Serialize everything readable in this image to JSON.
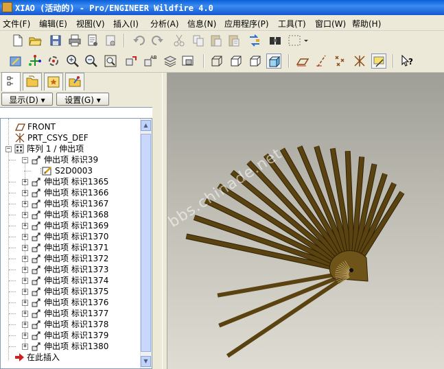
{
  "window": {
    "title": "XIAO (活动的) - Pro/ENGINEER Wildfire 4.0"
  },
  "menu": [
    "文件(F)",
    "编辑(E)",
    "视图(V)",
    "插入(I)",
    "分析(A)",
    "信息(N)",
    "应用程序(P)",
    "工具(T)",
    "窗口(W)",
    "帮助(H)"
  ],
  "toolbar1": [
    "new-icon",
    "open-icon",
    "save-icon",
    "print-icon",
    "email-icon",
    "copy-file-icon",
    "undo-icon",
    "redo-icon",
    "cut-icon",
    "copy-icon",
    "paste-icon",
    "paste-special-icon",
    "regenerate-icon",
    "find-icon",
    "select-box-icon"
  ],
  "toolbar2": [
    "repaint-icon",
    "spin-center-icon",
    "orient-mode-icon",
    "zoom-in-icon",
    "zoom-out-icon",
    "refit-icon",
    "reorient-icon",
    "saved-views-icon",
    "layers-icon",
    "view-manager-icon",
    "wireframe-icon",
    "hidden-line-icon",
    "no-hidden-icon",
    "shading-icon",
    "datum-planes-icon",
    "datum-axes-icon",
    "datum-points-icon",
    "coordinate-systems-icon",
    "annotations-icon",
    "whats-this-icon"
  ],
  "panel": {
    "tabs": [
      "model-tree-tab-icon",
      "folder-browser-tab-icon",
      "favorites-tab-icon",
      "connections-tab-icon"
    ],
    "show_label": "显示(D) ▾",
    "settings_label": "设置(G) ▾"
  },
  "tree": {
    "items": [
      {
        "label": "FRONT",
        "icon": "datum-plane-icon",
        "level": 1,
        "expander": ""
      },
      {
        "label": "PRT_CSYS_DEF",
        "icon": "coordinate-system-icon",
        "level": 1,
        "expander": ""
      },
      {
        "label": "阵列 1 / 伸出项",
        "icon": "pattern-icon",
        "level": 0,
        "expander": "-"
      },
      {
        "label": "伸出项 标识39",
        "icon": "extrude-icon",
        "level": 1,
        "expander": "-"
      },
      {
        "label": "S2D0003",
        "icon": "sketch-icon",
        "level": 2,
        "expander": ""
      },
      {
        "label": "伸出项 标识1365",
        "icon": "extrude-icon",
        "level": 1,
        "expander": "+"
      },
      {
        "label": "伸出项 标识1366",
        "icon": "extrude-icon",
        "level": 1,
        "expander": "+"
      },
      {
        "label": "伸出项 标识1367",
        "icon": "extrude-icon",
        "level": 1,
        "expander": "+"
      },
      {
        "label": "伸出项 标识1368",
        "icon": "extrude-icon",
        "level": 1,
        "expander": "+"
      },
      {
        "label": "伸出项 标识1369",
        "icon": "extrude-icon",
        "level": 1,
        "expander": "+"
      },
      {
        "label": "伸出项 标识1370",
        "icon": "extrude-icon",
        "level": 1,
        "expander": "+"
      },
      {
        "label": "伸出项 标识1371",
        "icon": "extrude-icon",
        "level": 1,
        "expander": "+"
      },
      {
        "label": "伸出项 标识1372",
        "icon": "extrude-icon",
        "level": 1,
        "expander": "+"
      },
      {
        "label": "伸出项 标识1373",
        "icon": "extrude-icon",
        "level": 1,
        "expander": "+"
      },
      {
        "label": "伸出项 标识1374",
        "icon": "extrude-icon",
        "level": 1,
        "expander": "+"
      },
      {
        "label": "伸出项 标识1375",
        "icon": "extrude-icon",
        "level": 1,
        "expander": "+"
      },
      {
        "label": "伸出项 标识1376",
        "icon": "extrude-icon",
        "level": 1,
        "expander": "+"
      },
      {
        "label": "伸出项 标识1377",
        "icon": "extrude-icon",
        "level": 1,
        "expander": "+"
      },
      {
        "label": "伸出项 标识1378",
        "icon": "extrude-icon",
        "level": 1,
        "expander": "+"
      },
      {
        "label": "伸出项 标识1379",
        "icon": "extrude-icon",
        "level": 1,
        "expander": "+"
      },
      {
        "label": "伸出项 标识1380",
        "icon": "extrude-icon",
        "level": 1,
        "expander": "+"
      },
      {
        "label": "在此插入",
        "icon": "insert-here-icon",
        "level": 0,
        "expander": ""
      }
    ]
  },
  "graphics": {
    "watermark": "bbs.chinade.net",
    "model": "fan-of-extruded-ribs",
    "rib_count": 17,
    "rib_color": "#5a4310"
  }
}
